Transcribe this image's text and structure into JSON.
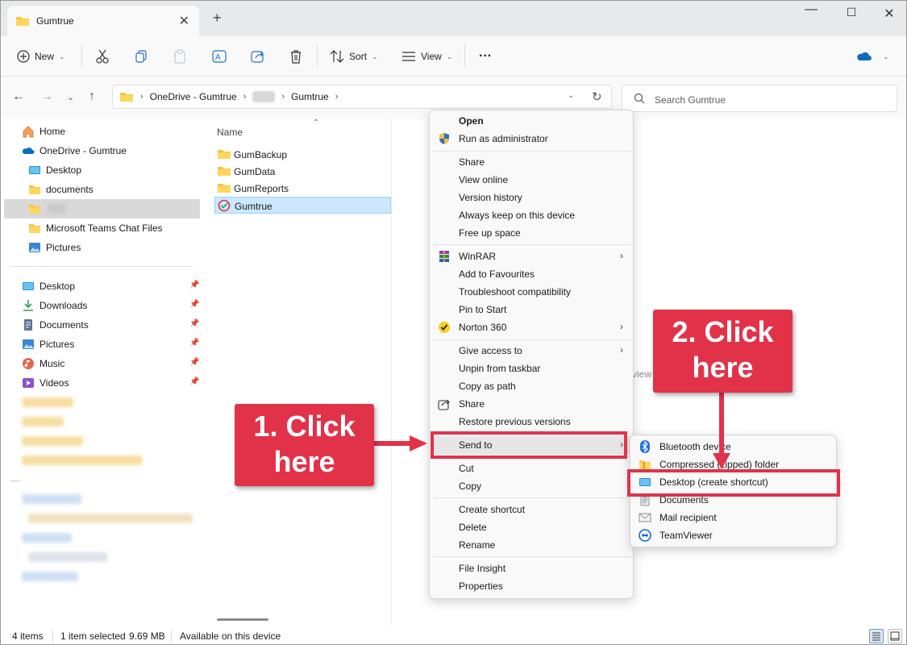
{
  "window": {
    "tab_title": "Gumtrue",
    "new_tab": "+",
    "minimize": "—",
    "maximize": "☐",
    "close": "✕"
  },
  "toolbar": {
    "new_label": "New",
    "sort_label": "Sort",
    "view_label": "View",
    "more_label": "···"
  },
  "address": {
    "crumbs": [
      "OneDrive - Gumtrue",
      "Gumtrue"
    ],
    "search_placeholder": "Search Gumtrue"
  },
  "nav": {
    "items": [
      {
        "label": "Home",
        "icon": "home-icon"
      },
      {
        "label": "OneDrive - Gumtrue",
        "icon": "onedrive-icon"
      },
      {
        "label": "Desktop",
        "icon": "desktop-icon"
      },
      {
        "label": "documents",
        "icon": "folder-icon"
      },
      {
        "label": "Microsoft Teams Chat Files",
        "icon": "folder-icon"
      },
      {
        "label": "Pictures",
        "icon": "pictures-icon"
      }
    ],
    "quick": [
      {
        "label": "Desktop",
        "icon": "desktop-icon"
      },
      {
        "label": "Downloads",
        "icon": "downloads-icon"
      },
      {
        "label": "Documents",
        "icon": "documents-icon"
      },
      {
        "label": "Pictures",
        "icon": "pictures-icon"
      },
      {
        "label": "Music",
        "icon": "music-icon"
      },
      {
        "label": "Videos",
        "icon": "videos-icon"
      }
    ]
  },
  "content": {
    "column_name": "Name",
    "files": [
      {
        "label": "GumBackup",
        "icon": "folder-icon"
      },
      {
        "label": "GumData",
        "icon": "folder-icon"
      },
      {
        "label": "GumReports",
        "icon": "folder-icon"
      },
      {
        "label": "Gumtrue",
        "icon": "app-icon",
        "selected": true
      }
    ],
    "ghost_text": "view"
  },
  "context_menu": {
    "groups": [
      [
        "Open",
        "Run as administrator"
      ],
      [
        "Share",
        "View online",
        "Version history",
        "Always keep on this device",
        "Free up space"
      ],
      [
        "WinRAR",
        "Add to Favourites",
        "Troubleshoot compatibility",
        "Pin to Start",
        "Norton 360"
      ],
      [
        "Give access to",
        "Unpin from taskbar",
        "Copy as path",
        "Share",
        "Restore previous versions"
      ],
      [
        "Send to"
      ],
      [
        "Cut",
        "Copy"
      ],
      [
        "Create shortcut",
        "Delete",
        "Rename"
      ],
      [
        "File Insight",
        "Properties"
      ]
    ]
  },
  "send_to_menu": {
    "items": [
      "Bluetooth device",
      "Compressed (zipped) folder",
      "Desktop (create shortcut)",
      "Documents",
      "Mail recipient",
      "TeamViewer"
    ]
  },
  "status": {
    "count": "4 items",
    "selected": "1 item selected",
    "size": "9.69 MB",
    "availability": "Available on this device"
  },
  "annotations": {
    "step1_line1": "1. Click",
    "step1_line2": "here",
    "step2_line1": "2. Click",
    "step2_line2": "here",
    "color": "#e2324a"
  }
}
